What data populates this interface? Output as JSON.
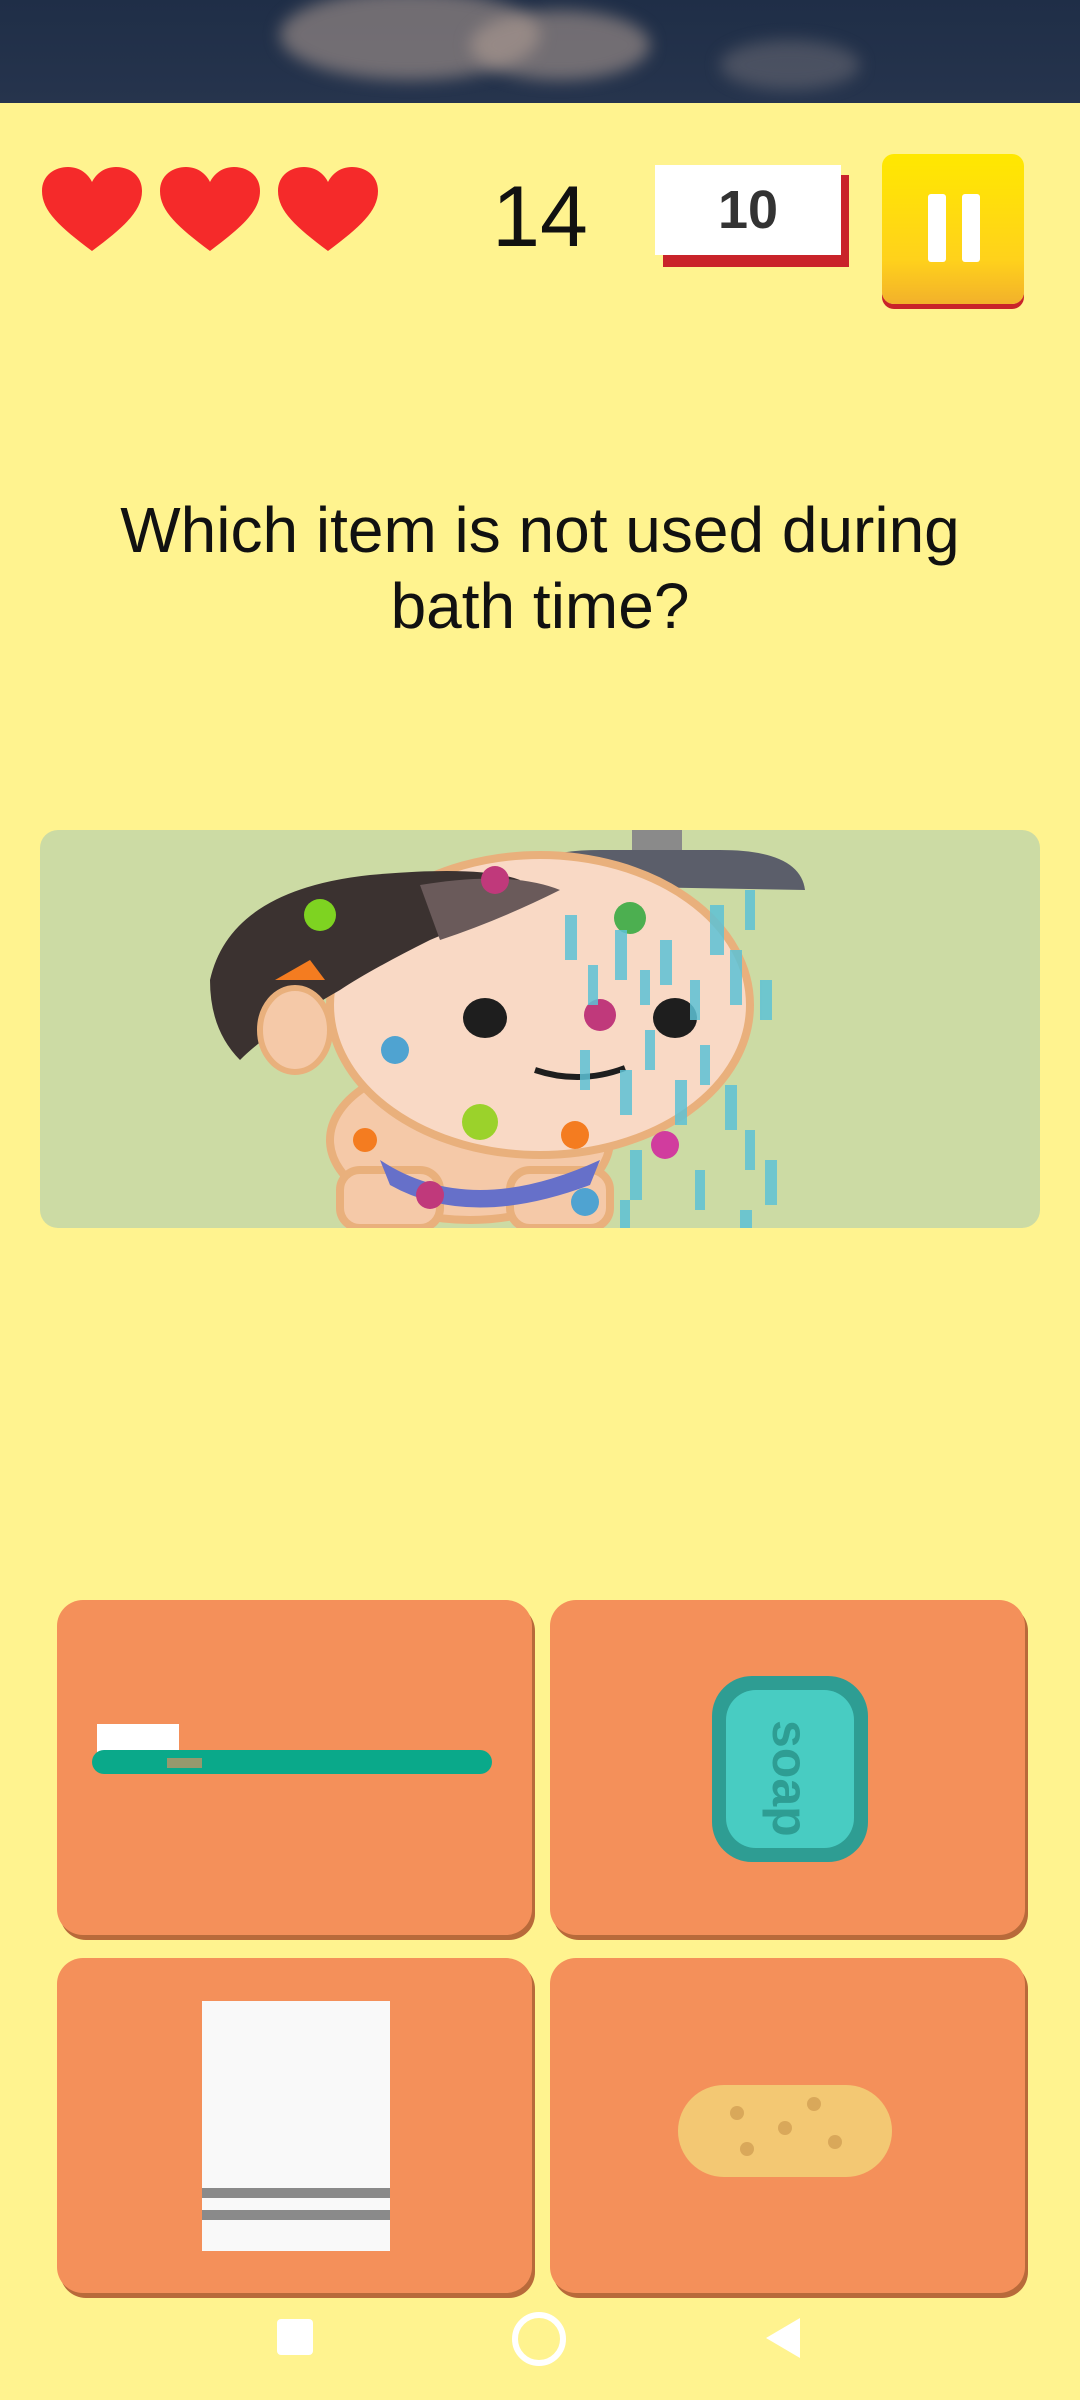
{
  "hud": {
    "lives": 3,
    "score": "14",
    "timer": "10",
    "pause_icon": "pause-icon"
  },
  "question": {
    "text": "Which item is not used during bath time?"
  },
  "scene": {
    "description_icon": "boy-showering-with-germs-illustration"
  },
  "answers": [
    {
      "id": "toothbrush",
      "icon": "toothbrush-icon"
    },
    {
      "id": "soap",
      "icon": "soap-bar-icon",
      "label": "soap"
    },
    {
      "id": "towel",
      "icon": "towel-icon"
    },
    {
      "id": "sponge",
      "icon": "sponge-icon"
    }
  ],
  "nav": {
    "recents_icon": "square-icon",
    "home_icon": "circle-icon",
    "back_icon": "triangle-back-icon"
  },
  "colors": {
    "background": "#fff38f",
    "heart": "#f52a2a",
    "answer_tile": "#f4905a",
    "pause_button": "#ffd21b",
    "timer_border": "#c9232a"
  }
}
